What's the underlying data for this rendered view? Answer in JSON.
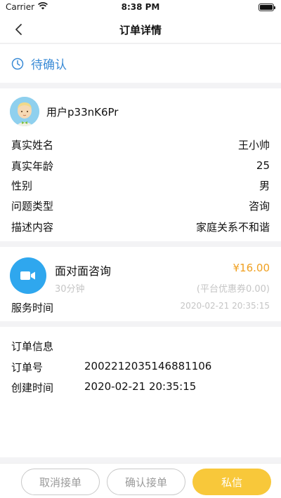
{
  "status_bar": {
    "carrier": "Carrier",
    "time": "8:38 PM"
  },
  "nav": {
    "title": "订单详情"
  },
  "order_state": {
    "label": "待确认"
  },
  "user": {
    "name": "用户p33nK6Pr",
    "fields": [
      {
        "label": "真实姓名",
        "value": "王小帅"
      },
      {
        "label": "真实年龄",
        "value": "25"
      },
      {
        "label": "性别",
        "value": "男"
      },
      {
        "label": "问题类型",
        "value": "咨询"
      },
      {
        "label": "描述内容",
        "value": "家庭关系不和谐"
      }
    ]
  },
  "service": {
    "name": "面对面咨询",
    "price": "¥16.00",
    "duration": "30分钟",
    "coupon": "(平台优惠券0.00)",
    "time_label": "服务时间",
    "time_value": "2020-02-21 20:35:15"
  },
  "order_info": {
    "title": "订单信息",
    "fields": [
      {
        "label": "订单号",
        "value": "2002212035146881106"
      },
      {
        "label": "创建时间",
        "value": "2020-02-21 20:35:15"
      }
    ]
  },
  "actions": {
    "cancel": "取消接单",
    "confirm": "确认接单",
    "chat": "私信"
  },
  "colors": {
    "accent_blue": "#3a8bd6",
    "price_orange": "#f0a020",
    "chat_yellow": "#f8c83a",
    "video_blue": "#2fa7ee"
  },
  "icons": {
    "state": "clock-icon",
    "service": "video-camera-icon",
    "back": "chevron-left-icon"
  }
}
